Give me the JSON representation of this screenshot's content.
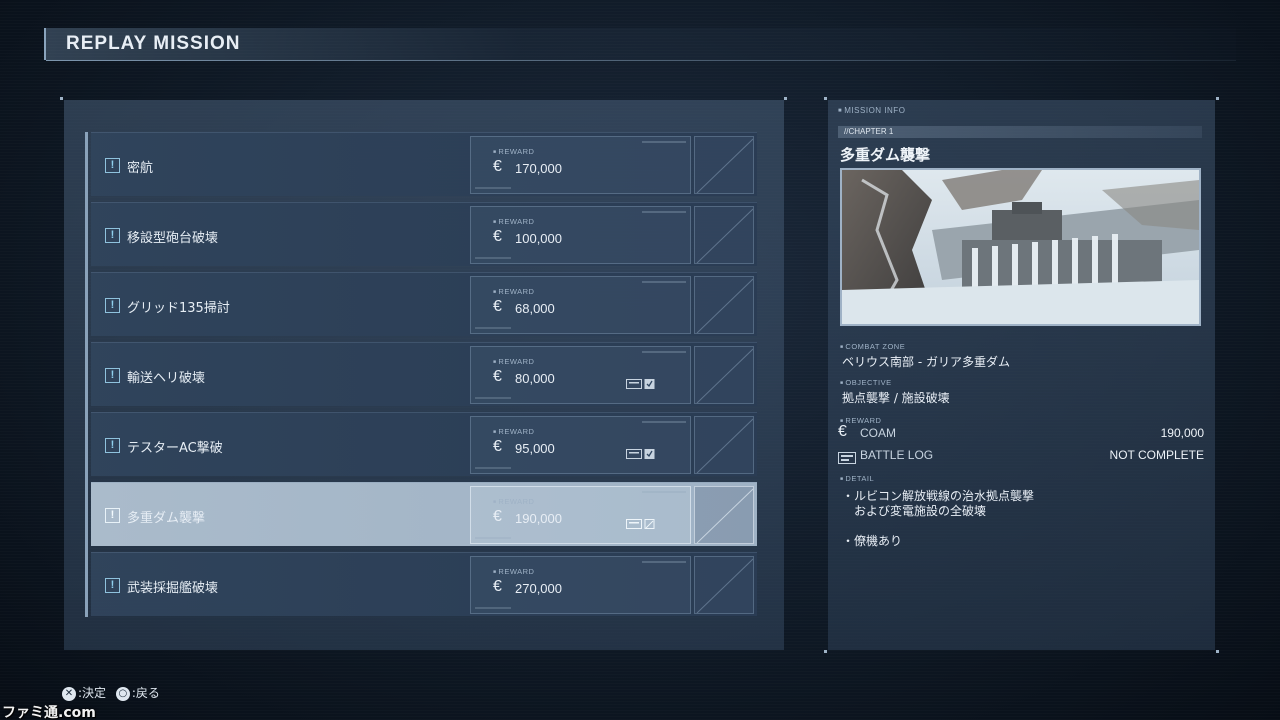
{
  "screen": {
    "title": "REPLAY MISSION"
  },
  "missions": [
    {
      "name": "密航",
      "reward_label": "REWARD",
      "currency": "€",
      "reward": "170,000",
      "battle_log": false,
      "selected": false
    },
    {
      "name": "移設型砲台破壊",
      "reward_label": "REWARD",
      "currency": "€",
      "reward": "100,000",
      "battle_log": false,
      "selected": false
    },
    {
      "name": "グリッド135掃討",
      "reward_label": "REWARD",
      "currency": "€",
      "reward": "68,000",
      "battle_log": false,
      "selected": false
    },
    {
      "name": "輸送ヘリ破壊",
      "reward_label": "REWARD",
      "currency": "€",
      "reward": "80,000",
      "battle_log": true,
      "selected": false
    },
    {
      "name": "テスターAC撃破",
      "reward_label": "REWARD",
      "currency": "€",
      "reward": "95,000",
      "battle_log": true,
      "selected": false
    },
    {
      "name": "多重ダム襲撃",
      "reward_label": "REWARD",
      "currency": "€",
      "reward": "190,000",
      "battle_log": true,
      "selected": true
    },
    {
      "name": "武装採掘艦破壊",
      "reward_label": "REWARD",
      "currency": "€",
      "reward": "270,000",
      "battle_log": false,
      "selected": false
    }
  ],
  "info": {
    "header": "MISSION INFO",
    "chapter": "//CHAPTER 1",
    "title": "多重ダム襲撃",
    "combat_zone_label": "COMBAT ZONE",
    "combat_zone": "ベリウス南部 - ガリア多重ダム",
    "objective_label": "OBJECTIVE",
    "objective": "拠点襲撃 / 施設破壊",
    "reward_label": "REWARD",
    "coam_label": "COAM",
    "coam_value": "190,000",
    "battle_log_label": "BATTLE LOG",
    "battle_log_value": "NOT COMPLETE",
    "detail_label": "DETAIL",
    "detail_lines": [
      "・ルビコン解放戦線の治水拠点襲撃",
      "　および変電施設の全破壊",
      "・僚機あり"
    ]
  },
  "footer": {
    "confirm_glyph": "✕",
    "confirm_label": ":決定",
    "back_glyph": "○",
    "back_label": ":戻る"
  },
  "watermark": "ファミ通.com",
  "colors": {
    "accent": "#8fd0ee",
    "selected_row": "#aabbcb",
    "panel": "#3c5068"
  }
}
